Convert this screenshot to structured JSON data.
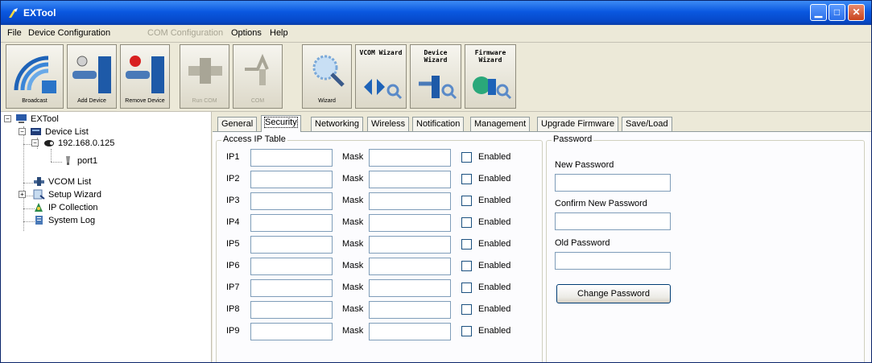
{
  "window": {
    "title": "EXTool"
  },
  "menu": [
    {
      "label": "File",
      "disabled": false
    },
    {
      "label": "Device Configuration",
      "disabled": false
    },
    {
      "label": "COM Configuration",
      "disabled": true
    },
    {
      "label": "Options",
      "disabled": false
    },
    {
      "label": "Help",
      "disabled": false
    }
  ],
  "toolbar": {
    "broadcast": "Broadcast",
    "add_device": "Add Device",
    "remove_device": "Remove Device",
    "disabled1": "Run COM",
    "disabled2": "COM",
    "wizard": "Wizard",
    "vcom_wizard": "VCOM Wizard",
    "device_wizard": "Device Wizard",
    "firmware_wizard": "Firmware Wizard"
  },
  "tree": {
    "root": "EXTool",
    "device_list": "Device List",
    "device_ip": "192.168.0.125",
    "port": "port1",
    "vcom_list": "VCOM List",
    "setup_wizard": "Setup Wizard",
    "ip_collection": "IP Collection",
    "system_log": "System Log"
  },
  "tabs": [
    {
      "label": "General",
      "active": false
    },
    {
      "label": "Security",
      "active": true
    },
    {
      "label": "Networking",
      "active": false
    },
    {
      "label": "Wireless",
      "active": false
    },
    {
      "label": "Notification",
      "active": false
    },
    {
      "label": "Management",
      "active": false
    },
    {
      "label": "Upgrade Firmware",
      "active": false
    },
    {
      "label": "Save/Load",
      "active": false
    }
  ],
  "access_ip": {
    "title": "Access IP Table",
    "mask_label": "Mask",
    "enabled_label": "Enabled",
    "rows": [
      {
        "label": "IP1",
        "ip": "",
        "mask": "",
        "enabled": false
      },
      {
        "label": "IP2",
        "ip": "",
        "mask": "",
        "enabled": false
      },
      {
        "label": "IP3",
        "ip": "",
        "mask": "",
        "enabled": false
      },
      {
        "label": "IP4",
        "ip": "",
        "mask": "",
        "enabled": false
      },
      {
        "label": "IP5",
        "ip": "",
        "mask": "",
        "enabled": false
      },
      {
        "label": "IP6",
        "ip": "",
        "mask": "",
        "enabled": false
      },
      {
        "label": "IP7",
        "ip": "",
        "mask": "",
        "enabled": false
      },
      {
        "label": "IP8",
        "ip": "",
        "mask": "",
        "enabled": false
      },
      {
        "label": "IP9",
        "ip": "",
        "mask": "",
        "enabled": false
      }
    ]
  },
  "password": {
    "title": "Password",
    "new_label": "New Password",
    "new_value": "",
    "confirm_label": "Confirm New Password",
    "confirm_value": "",
    "old_label": "Old Password",
    "old_value": "",
    "change_button": "Change Password"
  }
}
